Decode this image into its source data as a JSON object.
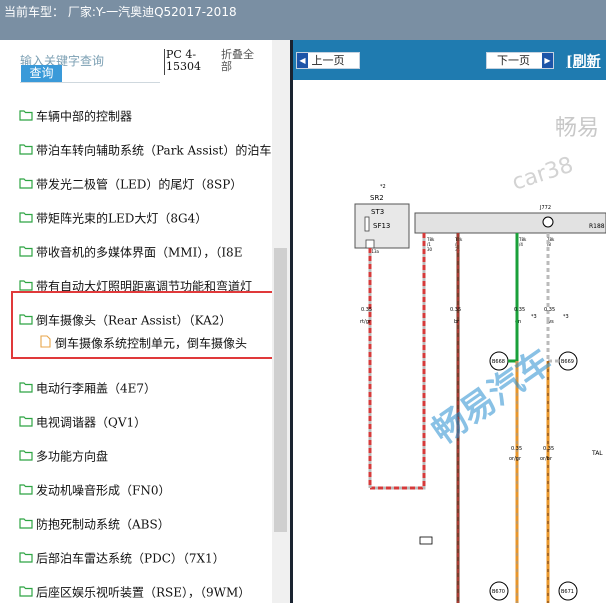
{
  "header": {
    "title": "当前车型： 厂家:Y-一汽奥迪Q52017-2018"
  },
  "search": {
    "placeholder": "输入关键字查询",
    "button_label": "查询",
    "pc_label": "PC 4-15304",
    "collapse_label": "折叠全部"
  },
  "tree": {
    "items": [
      {
        "label": "车辆中部的控制器"
      },
      {
        "label": "带泊车转向辅助系统（Park Assist）的泊车"
      },
      {
        "label": "带发光二极管（LED）的尾灯（8SP）"
      },
      {
        "label": "带矩阵光束的LED大灯（8G4）"
      },
      {
        "label": "带收音机的多媒体界面（MMI），（I8E"
      },
      {
        "label": "带有自动大灯照明距离调节功能和弯道灯"
      },
      {
        "label": "倒车摄像头（Rear Assist）（KA2）"
      },
      {
        "label": "电动行李厢盖（4E7）"
      },
      {
        "label": "电视调谐器（QV1）"
      },
      {
        "label": "多功能方向盘"
      },
      {
        "label": "发动机噪音形成（FN0）"
      },
      {
        "label": "防抱死制动系统（ABS）"
      },
      {
        "label": "后部泊车雷达系统（PDC）（7X1）"
      },
      {
        "label": "后座区娱乐视听装置（RSE），（9WM）"
      }
    ],
    "selected_child": {
      "label": "倒车摄像系统控制单元，倒车摄像头"
    }
  },
  "nav": {
    "prev_label": "上一页",
    "next_label": "下一页",
    "refresh_label": "[刷新"
  },
  "diagram": {
    "watermarks": [
      "畅易",
      "car38",
      "畅易汽车"
    ],
    "labels": {
      "sr": "SR2",
      "st": "ST3",
      "sf": "SF13",
      "top_mark": "*2",
      "j772": "J772",
      "r188": "R188",
      "tal": "TAL",
      "b668": "B668",
      "b669": "B669",
      "b670": "B670",
      "b671": "B671",
      "w1": "0.35",
      "w1c": "rt/gr",
      "w2": "0.35",
      "w2c": "br",
      "w3": "0.35",
      "w3c": "gn",
      "w4": "0.35",
      "w4c": "ws",
      "w5": "0.35",
      "w5c": "or/gr",
      "w6": "0.35",
      "w6c": "or/br",
      "t1": "T8k",
      "t1n": "/1",
      "t2": "T8k",
      "t2n": "/5",
      "t3": "T8k",
      "t3n": "/4",
      "t4": "T8k",
      "t4n": "/8",
      "t1b": "30",
      "t2b": "31",
      "tbox": "T13a",
      "star3a": "*3",
      "star3b": "*3",
      "t8b": "T8k",
      "t8bn": "/2"
    }
  },
  "colors": {
    "topbar": "#7a8fa3",
    "navbar": "#1f7bb0",
    "highlight": "#e0393a",
    "search_button": "#3a9ad9"
  }
}
